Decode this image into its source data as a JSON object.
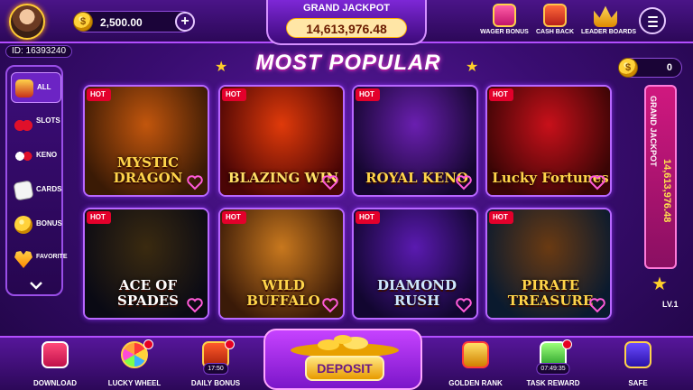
{
  "header": {
    "balance": "2,500.00",
    "user_id": "ID: 16393240",
    "grand_jackpot_title": "GRAND JACKPOT",
    "grand_jackpot_value": "14,613,976.48",
    "plus": "+",
    "coin_symbol": "$",
    "icons": [
      {
        "label": "WAGER BONUS",
        "icon": "gift-icon"
      },
      {
        "label": "CASH BACK",
        "icon": "wallet-icon"
      },
      {
        "label": "LEADER BOARDS",
        "icon": "crown-icon"
      }
    ]
  },
  "sidebar": {
    "items": [
      {
        "label": "ALL",
        "icon": "slot-machine-icon"
      },
      {
        "label": "SLOTS",
        "icon": "cherry-icon"
      },
      {
        "label": "KENO",
        "icon": "balls-icon"
      },
      {
        "label": "CARDS",
        "icon": "cards-icon"
      },
      {
        "label": "BONUS",
        "icon": "coin-stack-icon"
      },
      {
        "label": "FAVORITE",
        "icon": "heart-icon"
      }
    ]
  },
  "section_title": "MOST POPULAR",
  "games": [
    {
      "name": "MYSTIC DRAGON",
      "badge": "HOT",
      "colors": [
        "#3a1a05",
        "#c2560d"
      ],
      "text_color": "#ffd54a"
    },
    {
      "name": "BLAZING WIN",
      "badge": "HOT",
      "colors": [
        "#4a0505",
        "#e03a0a"
      ],
      "text_color": "#ffe066"
    },
    {
      "name": "ROYAL KENO",
      "badge": "HOT",
      "colors": [
        "#14062e",
        "#6a1fb0"
      ],
      "text_color": "#ffd54a"
    },
    {
      "name": "Lucky Fortunes",
      "badge": "HOT",
      "colors": [
        "#3a0505",
        "#c8101a"
      ],
      "text_color": "#ffd54a"
    },
    {
      "name": "ACE OF SPADES",
      "badge": "HOT",
      "colors": [
        "#0a0a14",
        "#3a2a10"
      ],
      "text_color": "#ffffff"
    },
    {
      "name": "WILD BUFFALO",
      "badge": "HOT",
      "colors": [
        "#3a1a08",
        "#c8781e"
      ],
      "text_color": "#ffd54a"
    },
    {
      "name": "DIAMOND RUSH",
      "badge": "HOT",
      "colors": [
        "#120630",
        "#5a1ab0"
      ],
      "text_color": "#cfe8ff"
    },
    {
      "name": "PIRATE TREASURE",
      "badge": "HOT",
      "colors": [
        "#0a1a2e",
        "#6a3a12"
      ],
      "text_color": "#ffd54a"
    }
  ],
  "right_panel": {
    "coin_count": "0",
    "grand_jackpot_title": "GRAND JACKPOT",
    "grand_jackpot_value": "14,613,976.48",
    "level": "LV.1"
  },
  "bottom": {
    "items": [
      {
        "label": "DOWNLOAD",
        "icon": "download-icon"
      },
      {
        "label": "LUCKY WHEEL",
        "icon": "wheel-icon"
      },
      {
        "label": "DAILY BONUS",
        "icon": "chest-icon",
        "timer": "17:50"
      },
      {
        "label": "GOLDEN RANK",
        "icon": "trophy-icon"
      },
      {
        "label": "TASK REWARD",
        "icon": "task-icon",
        "timer": "07:49:35"
      },
      {
        "label": "SAFE",
        "icon": "safe-icon"
      }
    ],
    "deposit_label": "DEPOSIT"
  }
}
